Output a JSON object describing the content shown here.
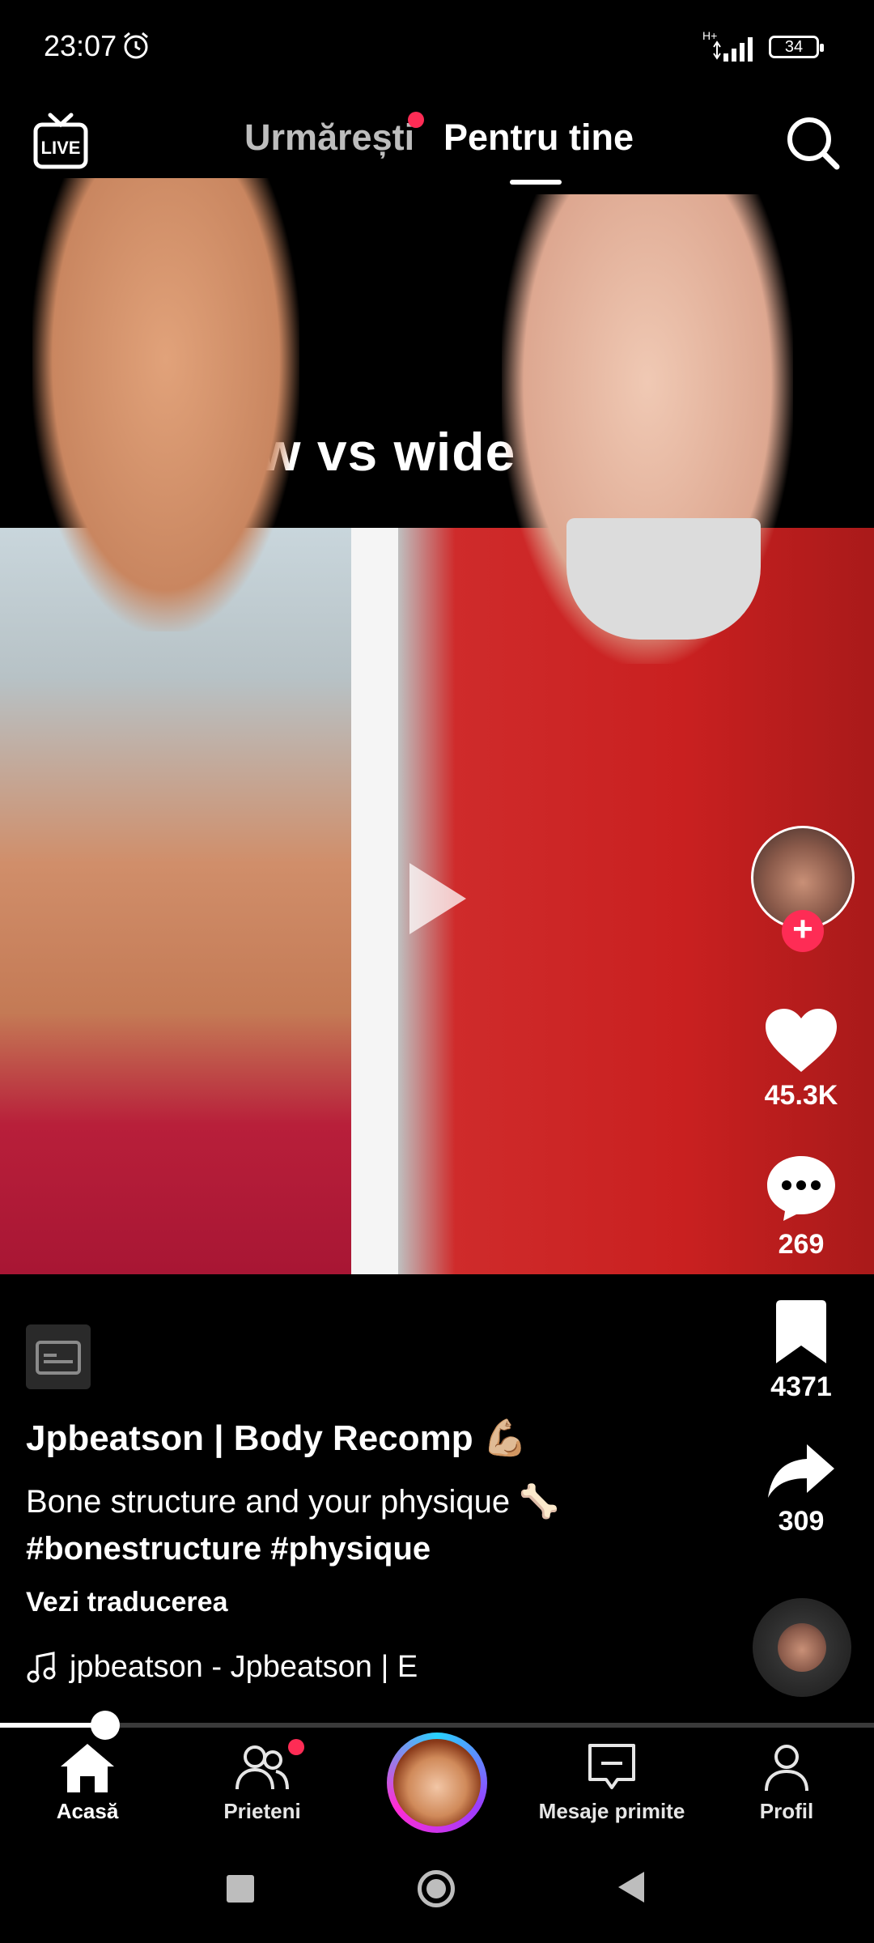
{
  "status": {
    "time": "23:07",
    "network": "H+",
    "battery": "34"
  },
  "topnav": {
    "live": "LIVE",
    "tabs": [
      "Urmărești",
      "Pentru tine"
    ],
    "active_tab": "Pentru tine"
  },
  "video": {
    "caption_title": "Narrow vs wide clavicles"
  },
  "actions": {
    "likes": "45.3K",
    "comments": "269",
    "saves": "4371",
    "shares": "309"
  },
  "post": {
    "author": "Jpbeatson | Body Recomp 💪🏼",
    "description": "Bone structure and your physique 🦴",
    "hashtags": "#bonestructure #physique",
    "translate": "Vezi traducerea",
    "music": "jpbeatson - Jpbeatson | E"
  },
  "progress": {
    "fraction": 0.12
  },
  "bottomnav": {
    "home": "Acasă",
    "friends": "Prieteni",
    "inbox": "Mesaje primite",
    "profile": "Profil"
  },
  "colors": {
    "accent": "#fe2c55"
  }
}
